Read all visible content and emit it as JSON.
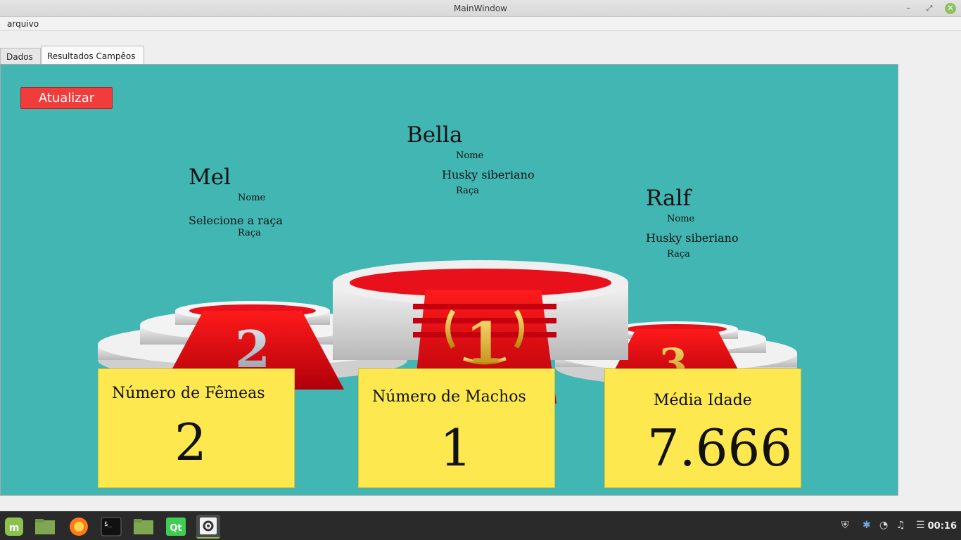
{
  "window": {
    "title": "MainWindow"
  },
  "menu": {
    "file_label": "arquivo"
  },
  "tabs": [
    {
      "label": "Dados"
    },
    {
      "label": "Resultados Campêos"
    }
  ],
  "actions": {
    "refresh_label": "Atualizar"
  },
  "podium": {
    "first": {
      "name": "Bella",
      "name_caption": "Nome",
      "breed": "Husky siberiano",
      "breed_caption": "Raça",
      "rank": "1"
    },
    "second": {
      "name": "Mel",
      "name_caption": "Nome",
      "breed": "Selecione a raça",
      "breed_caption": "Raça",
      "rank": "2"
    },
    "third": {
      "name": "Ralf",
      "name_caption": "Nome",
      "breed": "Husky siberiano",
      "breed_caption": "Raça",
      "rank": "3"
    }
  },
  "stats": {
    "females": {
      "label": "Número de Fêmeas",
      "value": "2"
    },
    "males": {
      "label": "Número de Machos",
      "value": "1"
    },
    "avg_age": {
      "label": "Média Idade",
      "value": "7.666"
    }
  },
  "taskbar": {
    "clock": "00:16",
    "apps": [
      "mint-menu-icon",
      "files-folder-icon",
      "firefox-icon",
      "terminal-icon",
      "folder-icon",
      "qt-creator-icon",
      "settings-icon"
    ]
  },
  "colors": {
    "panel_bg": "#42b6b2",
    "button_red": "#f13c3c",
    "card_yellow": "#fde84f",
    "carpet_red": "#e0101a"
  }
}
